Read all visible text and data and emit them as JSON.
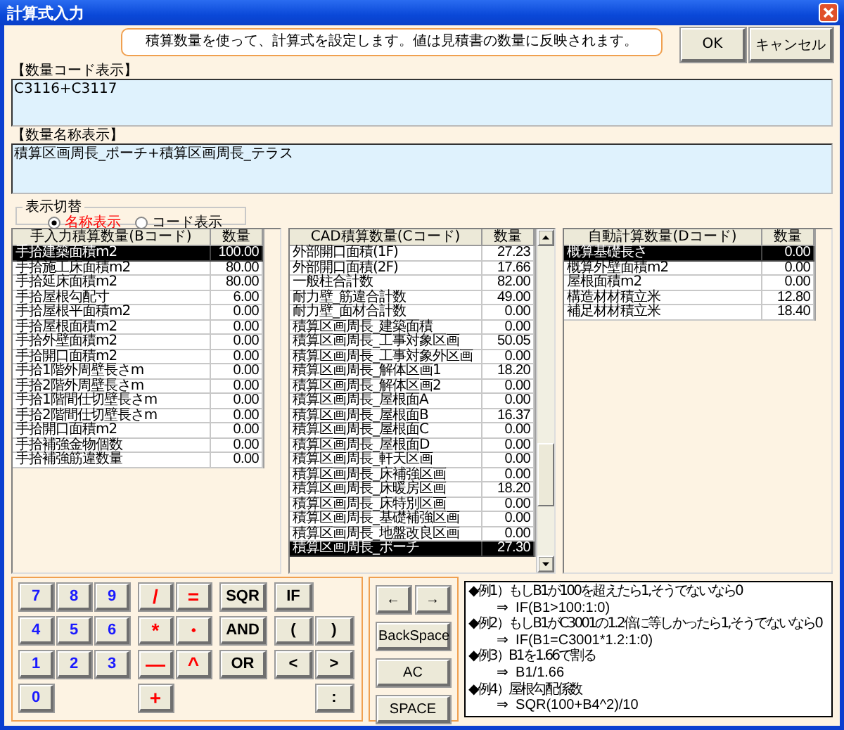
{
  "window": {
    "title": "計算式入力"
  },
  "info_text": "積算数量を使って、計算式を設定します。値は見積書の数量に反映されます。",
  "buttons": [
    "OK",
    "キャンセル"
  ],
  "code_display": {
    "label": "【数量コード表示】",
    "value": "C3116+C3117"
  },
  "name_display": {
    "label": "【数量名称表示】",
    "value": "積算区画周長_ポーチ+積算区画周長_テラス"
  },
  "display_toggle": {
    "title": "表示切替",
    "options": [
      {
        "label": "名称表示",
        "selected": true
      },
      {
        "label": "コード表示",
        "selected": false
      }
    ]
  },
  "tables": [
    {
      "columns": [
        "手入力積算数量(Bコード)",
        "数量"
      ],
      "scrollbar": false,
      "rows": [
        {
          "name": "手拾建築面積m2",
          "qty": "100.00",
          "selected": true
        },
        {
          "name": "手拾施工床面積m2",
          "qty": "80.00",
          "selected": false
        },
        {
          "name": "手拾延床面積m2",
          "qty": "80.00",
          "selected": false
        },
        {
          "name": "手拾屋根勾配寸",
          "qty": "6.00",
          "selected": false
        },
        {
          "name": "手拾屋根平面積m2",
          "qty": "0.00",
          "selected": false
        },
        {
          "name": "手拾屋根面積m2",
          "qty": "0.00",
          "selected": false
        },
        {
          "name": "手拾外壁面積m2",
          "qty": "0.00",
          "selected": false
        },
        {
          "name": "手拾開口面積m2",
          "qty": "0.00",
          "selected": false
        },
        {
          "name": "手拾1階外周壁長さm",
          "qty": "0.00",
          "selected": false
        },
        {
          "name": "手拾2階外周壁長さm",
          "qty": "0.00",
          "selected": false
        },
        {
          "name": "手拾1階間仕切壁長さm",
          "qty": "0.00",
          "selected": false
        },
        {
          "name": "手拾2階間仕切壁長さm",
          "qty": "0.00",
          "selected": false
        },
        {
          "name": "手拾開口面積m2",
          "qty": "0.00",
          "selected": false
        },
        {
          "name": "手拾補強金物個数",
          "qty": "0.00",
          "selected": false
        },
        {
          "name": "手拾補強筋違数量",
          "qty": "0.00",
          "selected": false
        }
      ]
    },
    {
      "columns": [
        "CAD積算数量(Cコード)",
        "数量"
      ],
      "scrollbar": true,
      "rows": [
        {
          "name": "外部開口面積(1F)",
          "qty": "27.23",
          "selected": false
        },
        {
          "name": "外部開口面積(2F)",
          "qty": "17.66",
          "selected": false
        },
        {
          "name": "一般柱合計数",
          "qty": "82.00",
          "selected": false
        },
        {
          "name": "耐力壁_筋違合計数",
          "qty": "49.00",
          "selected": false
        },
        {
          "name": "耐力壁_面材合計数",
          "qty": "0.00",
          "selected": false
        },
        {
          "name": "積算区画周長_建築面積",
          "qty": "0.00",
          "selected": false
        },
        {
          "name": "積算区画周長_工事対象区画",
          "qty": "50.05",
          "selected": false
        },
        {
          "name": "積算区画周長_工事対象外区画",
          "qty": "0.00",
          "selected": false
        },
        {
          "name": "積算区画周長_解体区画1",
          "qty": "18.20",
          "selected": false
        },
        {
          "name": "積算区画周長_解体区画2",
          "qty": "0.00",
          "selected": false
        },
        {
          "name": "積算区画周長_屋根面A",
          "qty": "0.00",
          "selected": false
        },
        {
          "name": "積算区画周長_屋根面B",
          "qty": "16.37",
          "selected": false
        },
        {
          "name": "積算区画周長_屋根面C",
          "qty": "0.00",
          "selected": false
        },
        {
          "name": "積算区画周長_屋根面D",
          "qty": "0.00",
          "selected": false
        },
        {
          "name": "積算区画周長_軒天区画",
          "qty": "0.00",
          "selected": false
        },
        {
          "name": "積算区画周長_床補強区画",
          "qty": "0.00",
          "selected": false
        },
        {
          "name": "積算区画周長_床暖房区画",
          "qty": "18.20",
          "selected": false
        },
        {
          "name": "積算区画周長_床特別区画",
          "qty": "0.00",
          "selected": false
        },
        {
          "name": "積算区画周長_基礎補強区画",
          "qty": "0.00",
          "selected": false
        },
        {
          "name": "積算区画周長_地盤改良区画",
          "qty": "0.00",
          "selected": false
        },
        {
          "name": "積算区画周長_ポーチ",
          "qty": "27.30",
          "selected": true
        }
      ]
    },
    {
      "columns": [
        "自動計算数量(Dコード)",
        "数量"
      ],
      "scrollbar": false,
      "rows": [
        {
          "name": "概算基礎長さ",
          "qty": "0.00",
          "selected": true
        },
        {
          "name": "概算外壁面積m2",
          "qty": "0.00",
          "selected": false
        },
        {
          "name": "屋根面積m2",
          "qty": "0.00",
          "selected": false
        },
        {
          "name": "構造材材積立米",
          "qty": "12.80",
          "selected": false
        },
        {
          "name": "補足材材積立米",
          "qty": "18.40",
          "selected": false
        }
      ]
    }
  ],
  "keypad": [
    {
      "kind": "digit",
      "keys": [
        "7",
        "8",
        "9",
        "4",
        "5",
        "6",
        "1",
        "2",
        "3",
        "0"
      ]
    },
    {
      "kind": "operator",
      "keys": [
        "/",
        "=",
        "*",
        "・",
        "—",
        "^",
        "+"
      ]
    },
    {
      "kind": "function",
      "keys": [
        "SQR",
        "AND",
        "OR"
      ]
    },
    {
      "kind": "bracket",
      "keys": [
        "IF",
        "(",
        ")",
        "<",
        ">",
        ":"
      ]
    }
  ],
  "nav_keys": [
    "←",
    "→",
    "BackSpace",
    "AC",
    "SPACE"
  ],
  "examples": [
    {
      "title": "◆例1）もしB1が100を超えたら1,そうでないなら0",
      "formula": "⇒  IF(B1>100:1:0)"
    },
    {
      "title": "◆例2）もしB1がC3001の1.2倍に等しかったら1,そうでないなら0",
      "formula": "⇒  IF(B1=C3001*1.2:1:0)"
    },
    {
      "title": "◆例3）B1を1.66で割る",
      "formula": "⇒  B1/1.66"
    },
    {
      "title": "◆例4）屋根勾配係数",
      "formula": "⇒  SQR(100+B4^2)/10"
    }
  ]
}
